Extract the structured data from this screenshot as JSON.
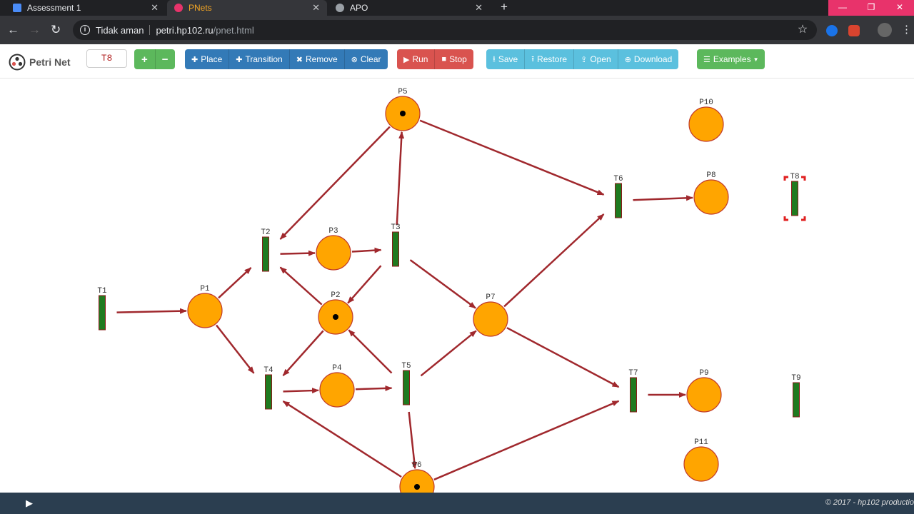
{
  "browser": {
    "tabs": [
      {
        "title": "Assessment 1",
        "icon": "user-account-icon",
        "active": false
      },
      {
        "title": "PNets",
        "icon": "pnets-favicon-icon",
        "active": true
      },
      {
        "title": "APO",
        "icon": "globe-icon",
        "active": false
      }
    ],
    "new_tab": "+",
    "window_controls": {
      "minimize": "—",
      "restore": "❐",
      "close": "✕"
    },
    "address": {
      "security_text": "Tidak aman",
      "host": "petri.hp102.ru",
      "path": "/pnet.html"
    }
  },
  "app": {
    "logo_text": "Petri Net",
    "selected_node": "T8",
    "buttons": {
      "add": "+",
      "remove_minus": "−",
      "place": "Place",
      "transition": "Transition",
      "remove": "Remove",
      "clear": "Clear",
      "run": "Run",
      "stop": "Stop",
      "save": "Save",
      "restore": "Restore",
      "open": "Open",
      "download": "Download",
      "examples": "Examples"
    }
  },
  "net": {
    "places": [
      {
        "id": "P1",
        "tokens": 0
      },
      {
        "id": "P2",
        "tokens": 1
      },
      {
        "id": "P3",
        "tokens": 0
      },
      {
        "id": "P4",
        "tokens": 0
      },
      {
        "id": "P5",
        "tokens": 1
      },
      {
        "id": "P6",
        "tokens": 1
      },
      {
        "id": "P7",
        "tokens": 0
      },
      {
        "id": "P8",
        "tokens": 0
      },
      {
        "id": "P9",
        "tokens": 0
      },
      {
        "id": "P10",
        "tokens": 0
      },
      {
        "id": "P11",
        "tokens": 0
      }
    ],
    "transitions": [
      "T1",
      "T2",
      "T3",
      "T4",
      "T5",
      "T6",
      "T7",
      "T8",
      "T9"
    ],
    "selected": "T8",
    "arcs": [
      [
        "T1",
        "P1"
      ],
      [
        "P1",
        "T2"
      ],
      [
        "P1",
        "T4"
      ],
      [
        "T2",
        "P3"
      ],
      [
        "P3",
        "T3"
      ],
      [
        "T3",
        "P5"
      ],
      [
        "T3",
        "P2"
      ],
      [
        "T3",
        "P7"
      ],
      [
        "P5",
        "T2"
      ],
      [
        "P5",
        "T6"
      ],
      [
        "P2",
        "T2"
      ],
      [
        "P2",
        "T4"
      ],
      [
        "T4",
        "P4"
      ],
      [
        "P4",
        "T5"
      ],
      [
        "T5",
        "P2"
      ],
      [
        "T5",
        "P7"
      ],
      [
        "T5",
        "P6"
      ],
      [
        "P6",
        "T4"
      ],
      [
        "P6",
        "T7"
      ],
      [
        "P7",
        "T6"
      ],
      [
        "P7",
        "T7"
      ],
      [
        "T6",
        "P8"
      ],
      [
        "T7",
        "P9"
      ]
    ],
    "colors": {
      "place": "#ffa500",
      "place_stroke": "#c0392b",
      "transition": "#1f7a1f",
      "arc": "#a0282d",
      "selection": "#e02020"
    }
  },
  "footer": {
    "copyright": "© 2017 - hp102 productio"
  }
}
